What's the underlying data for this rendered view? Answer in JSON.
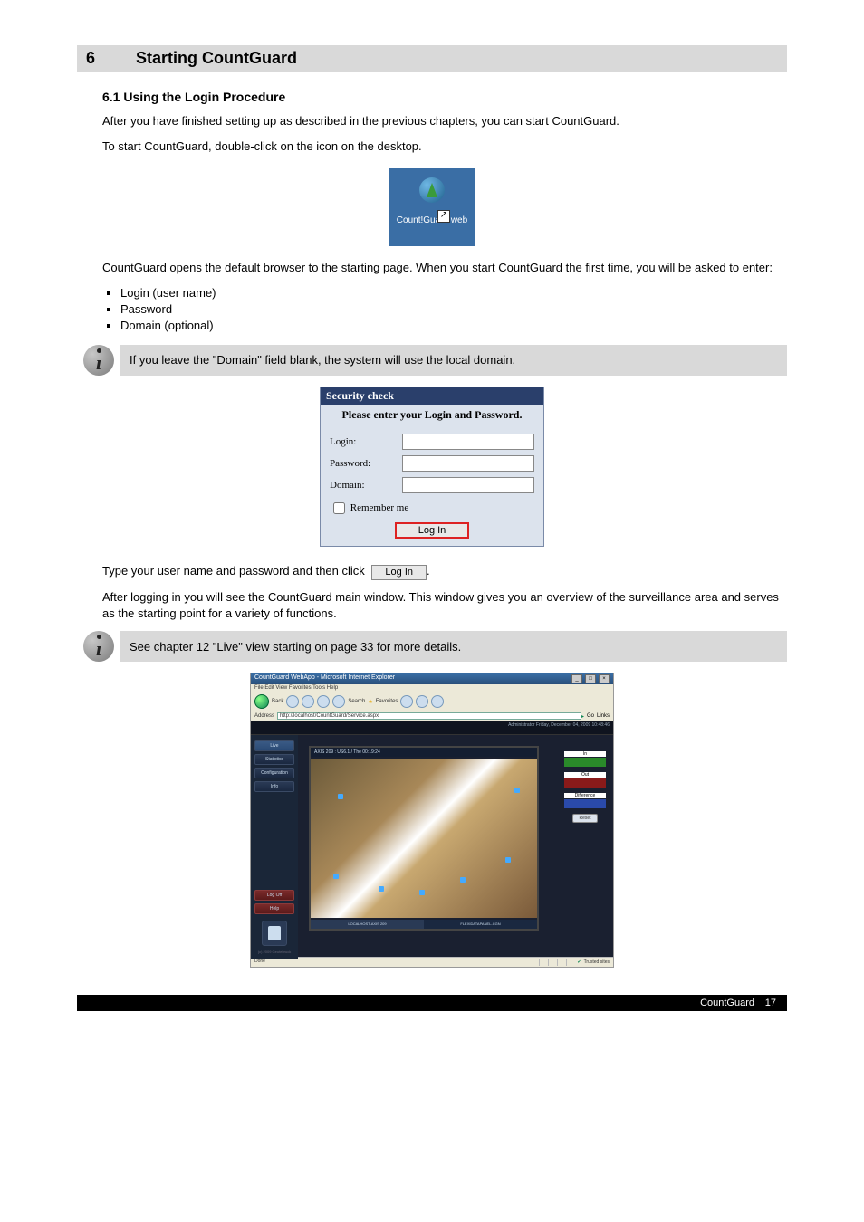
{
  "header": {
    "section_number": "6",
    "section_title": "Starting CountGuard"
  },
  "intro": {
    "sub": "6.1 Using the Login Procedure",
    "p1": "After you have finished setting up as described in the previous chapters, you can start CountGuard.",
    "p2": "To start CountGuard, double-click on the              icon on the desktop.",
    "p3": "CountGuard opens the default browser to the starting page. When you start CountGuard the first time, you will be asked to enter:",
    "p4_after_login": "After logging in you will see the CountGuard main window. This window gives you an overview of the surveillance area and serves as the starting point for  a variety of functions.",
    "p5_instruction": "Type your user name and password  and then click"
  },
  "desktop_icon_label": "Count!Guard web",
  "bullets": [
    "Login (user name)",
    "Password",
    "Domain (optional)"
  ],
  "info1": "If you leave the \"Domain\" field blank, the system will use the local domain.",
  "info2": "See chapter 12 \"Live\" view starting on page 33 for more details.",
  "security": {
    "title": "Security check",
    "subtitle": "Please enter your Login and Password.",
    "login_label": "Login:",
    "password_label": "Password:",
    "domain_label": "Domain:",
    "remember": "Remember me",
    "button": "Log In"
  },
  "app": {
    "ie_title": "CountGuard WebApp - Microsoft Internet Explorer",
    "menu": "File   Edit   View   Favorites   Tools   Help",
    "back": "Back",
    "search": "Search",
    "favorites": "Favorites",
    "address_label": "Address",
    "address": "http://localhost/CountGuard/Service.aspx",
    "go": "Go",
    "links": "Links",
    "topbar_right": "Administrator        Friday, December 04, 2009 10:48:46",
    "sidebar": [
      {
        "label": "Live",
        "class": "active"
      },
      {
        "label": "Statistics",
        "class": ""
      },
      {
        "label": "Configuration",
        "class": ""
      },
      {
        "label": "Info",
        "class": ""
      }
    ],
    "sidebar_bottom": [
      {
        "label": "Log Off",
        "class": "red"
      },
      {
        "label": "Help",
        "class": "red"
      }
    ],
    "video_title": "AXIS 209 : US6.1 / The 00:19:24",
    "video_footer_left": "LOCALHOST-AXIS 209",
    "video_footer_right": "FLEXIDATAPANEL-CGN",
    "right": {
      "in_label": "In",
      "in_val": "",
      "out_label": "Out",
      "out_val": "",
      "diff_label": "Difference",
      "diff_val": "",
      "reset": "Reset"
    },
    "status_left": "Done",
    "status_right": "Trusted sites",
    "copyright": "(c) 2009 Geutebruck"
  },
  "footer": {
    "product": "CountGuard",
    "page": "17"
  }
}
